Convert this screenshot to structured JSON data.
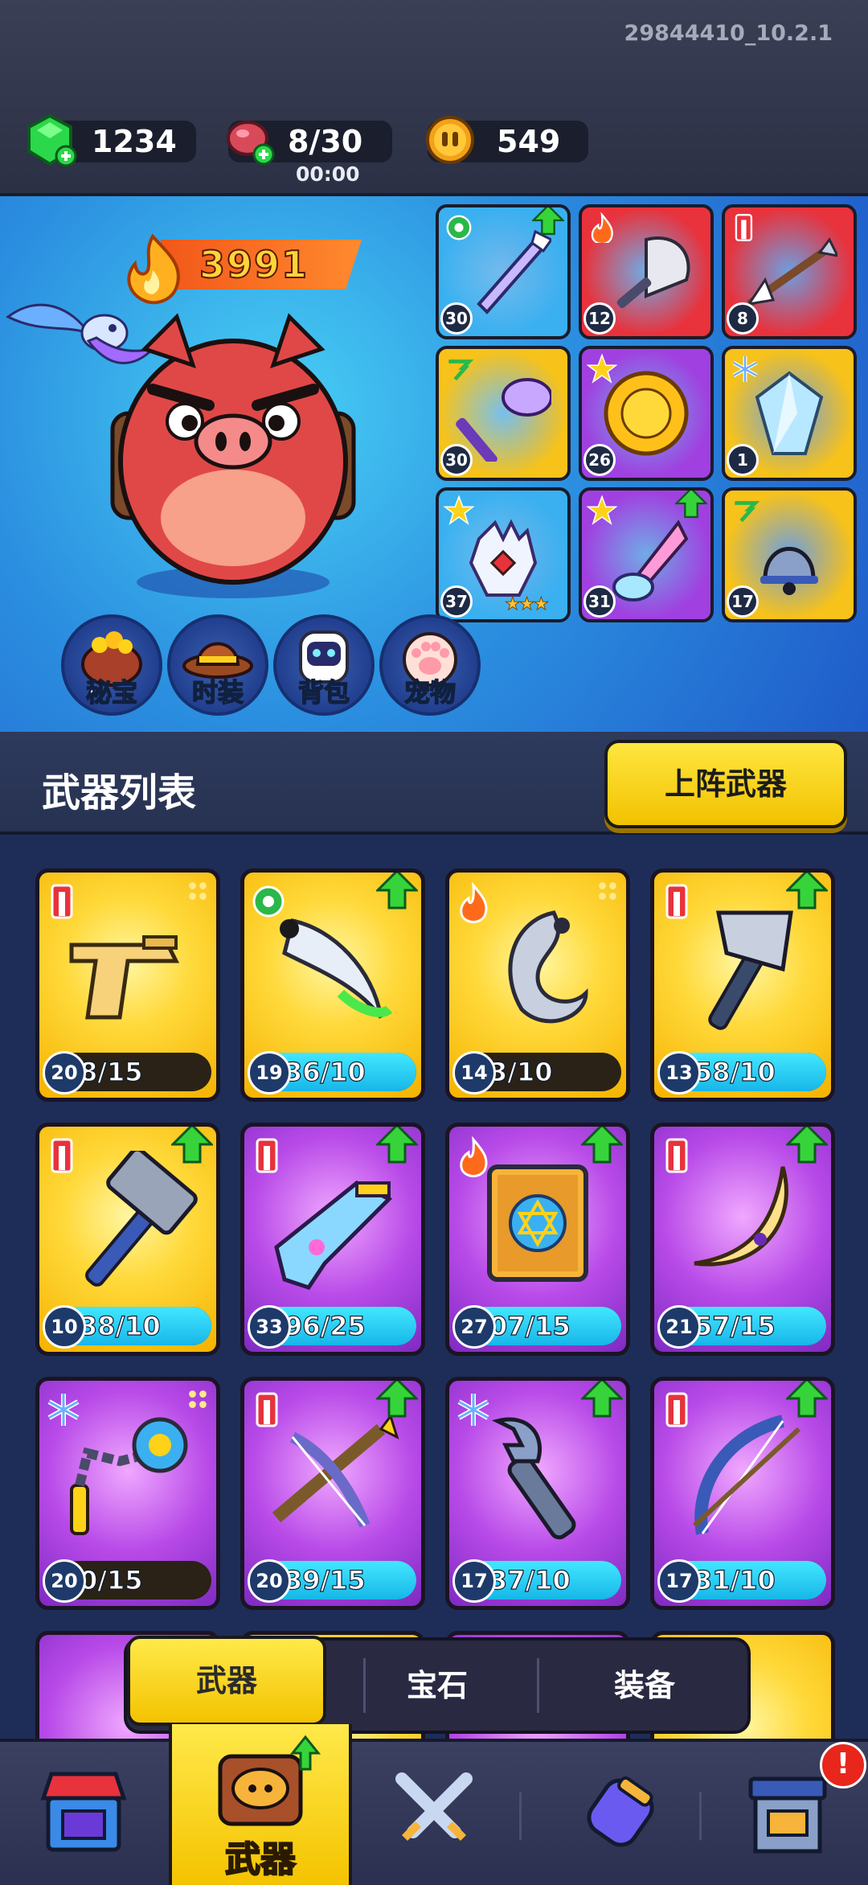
{
  "header": {
    "version": "29844410_10.2.1",
    "gems": "1234",
    "stamina": "8/30",
    "stamina_timer": "00:00",
    "coins": "549"
  },
  "hero": {
    "power": "3991",
    "nav": [
      {
        "label": "秘宝",
        "icon": "treasure-pot-icon"
      },
      {
        "label": "时装",
        "icon": "cowboy-hat-icon"
      },
      {
        "label": "背包",
        "icon": "robot-backpack-icon"
      },
      {
        "label": "宠物",
        "icon": "paw-icon"
      }
    ],
    "equipped": [
      {
        "level": "30",
        "color": "#3ab0f0",
        "icon": "crystal-spear-icon",
        "upgrade": true
      },
      {
        "level": "12",
        "color": "#e8323c",
        "icon": "feather-fan-icon"
      },
      {
        "level": "8",
        "color": "#e8323c",
        "icon": "arrow-icon"
      },
      {
        "level": "30",
        "color": "#f7c21a",
        "icon": "magic-staff-icon"
      },
      {
        "level": "26",
        "color": "#a040e0",
        "icon": "golden-shield-icon"
      },
      {
        "level": "1",
        "color": "#f7c21a",
        "icon": "ice-crystal-icon"
      },
      {
        "level": "37",
        "color": "#3ab0f0",
        "icon": "glove-icon",
        "stars": "★★★"
      },
      {
        "level": "31",
        "color": "#a040e0",
        "icon": "drill-icon",
        "upgrade": true
      },
      {
        "level": "17",
        "color": "#f7c21a",
        "icon": "bell-icon"
      }
    ]
  },
  "weapon_list": {
    "title": "武器列表",
    "deploy_button": "上阵武器",
    "cards": [
      {
        "level": "20",
        "progress": "8/15",
        "fill": 0,
        "rarity": "gold",
        "icon": "pistol-icon",
        "upgrade": false
      },
      {
        "level": "19",
        "progress": "36/10",
        "fill": 1,
        "rarity": "gold",
        "icon": "scimitar-icon",
        "upgrade": true
      },
      {
        "level": "14",
        "progress": "3/10",
        "fill": 0,
        "rarity": "gold",
        "icon": "hook-blade-icon",
        "upgrade": false
      },
      {
        "level": "13",
        "progress": "58/10",
        "fill": 1,
        "rarity": "gold",
        "icon": "axe-icon",
        "upgrade": true
      },
      {
        "level": "10",
        "progress": "38/10",
        "fill": 1,
        "rarity": "gold",
        "icon": "hammer-icon",
        "upgrade": true
      },
      {
        "level": "33",
        "progress": "96/25",
        "fill": 1,
        "rarity": "purple",
        "icon": "blaster-icon",
        "upgrade": true
      },
      {
        "level": "27",
        "progress": "07/15",
        "fill": 1,
        "rarity": "purple",
        "icon": "spellbook-icon",
        "upgrade": true
      },
      {
        "level": "21",
        "progress": "57/15",
        "fill": 1,
        "rarity": "purple",
        "icon": "boomerang-icon",
        "upgrade": true
      },
      {
        "level": "20",
        "progress": "0/15",
        "fill": 0,
        "rarity": "purple",
        "icon": "flail-icon",
        "upgrade": false
      },
      {
        "level": "20",
        "progress": "39/15",
        "fill": 1,
        "rarity": "purple",
        "icon": "crossbow-icon",
        "upgrade": true
      },
      {
        "level": "17",
        "progress": "37/10",
        "fill": 1,
        "rarity": "purple",
        "icon": "wrench-icon",
        "upgrade": true
      },
      {
        "level": "17",
        "progress": "31/10",
        "fill": 1,
        "rarity": "purple",
        "icon": "bow-icon",
        "upgrade": true
      }
    ]
  },
  "tabs": {
    "weapon": "武器",
    "gem": "宝石",
    "equipment": "装备"
  },
  "bottom_nav": {
    "weapon_label": "武器",
    "notification": "!"
  },
  "colors": {
    "accent_yellow": "#f4c300",
    "upgrade_green": "#36d43a",
    "progress_cyan": "#17b6e8"
  }
}
